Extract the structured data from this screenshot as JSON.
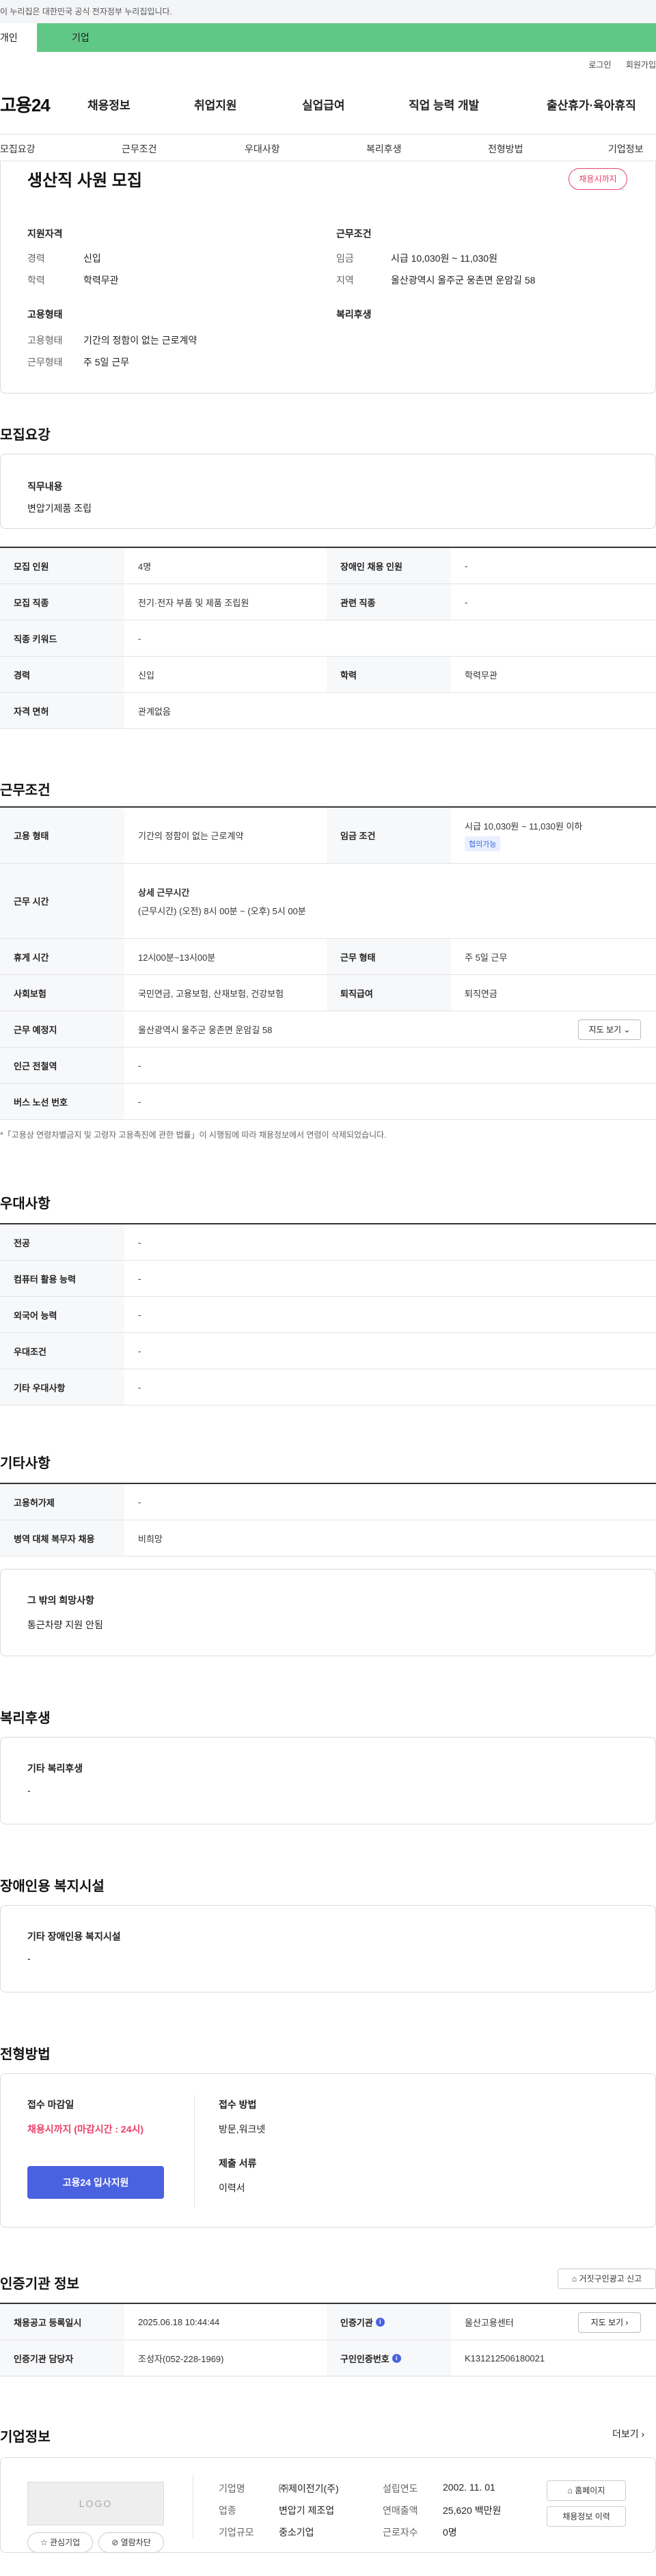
{
  "gov_banner": "이 누리집은 대한민국 공식 전자정부 누리집입니다.",
  "tabs": {
    "personal": "개인",
    "company": "기업"
  },
  "util": {
    "login": "로그인",
    "signup": "회원가입"
  },
  "logo": "고용24",
  "gnb": [
    "채용정보",
    "취업지원",
    "실업급여",
    "직업 능력 개발",
    "출산휴가·육아휴직"
  ],
  "subnav": [
    "모집요강",
    "근무조건",
    "우대사항",
    "복리후생",
    "전형방법",
    "기업정보"
  ],
  "job": {
    "title": "생산직 사원 모집",
    "deadline_badge": "채용시까지",
    "qual_heading": "지원자격",
    "cond_heading": "근무조건",
    "career_label": "경력",
    "career": "신입",
    "edu_label": "학력",
    "edu": "학력무관",
    "wage_label": "임금",
    "wage": "시급 10,030원 ~ 11,030원",
    "region_label": "지역",
    "region": "울산광역시 울주군 웅촌면 운암길 58",
    "emptype_heading": "고용형태",
    "welfare_heading": "복리후생",
    "emptype_label": "고용형태",
    "emptype": "기간의 정함이 없는 근로계약",
    "worktype_label": "근무형태",
    "worktype": "주 5일 근무"
  },
  "recruit": {
    "title": "모집요강",
    "duty_heading": "직무내용",
    "duty": "변압기제품 조립",
    "rows": [
      [
        "모집 인원",
        "4명",
        "장애인 채용 인원",
        "-"
      ],
      [
        "모집 직종",
        "전기·전자 부품 및 제품 조립원",
        "관련 직종",
        "-"
      ],
      [
        "직종 키워드",
        "-",
        "",
        ""
      ],
      [
        "경력",
        "신입",
        "학력",
        "학력무관"
      ],
      [
        "자격 면허",
        "관계없음",
        "",
        ""
      ]
    ]
  },
  "work": {
    "title": "근무조건",
    "emptype_th": "고용 형태",
    "emptype": "기간의 정함이 없는 근로계약",
    "wage_th": "임금 조건",
    "wage": "시급 10,030원 ~ 11,030원 이하",
    "wage_tag": "협의가능",
    "hours_th": "근무 시간",
    "hours_h": "상세 근무시간",
    "hours": "(근무시간) (오전) 8시 00분 ~ (오후) 5시 00분",
    "break_th": "휴게 시간",
    "break": "12시00분~13시00분",
    "worktype_th": "근무 형태",
    "worktype": "주 5일 근무",
    "insurance_th": "사회보험",
    "insurance": "국민연금, 고용보험, 산재보험, 건강보험",
    "severance_th": "퇴직급여",
    "severance": "퇴직연금",
    "place_th": "근무 예정지",
    "place": "울산광역시 울주군 웅촌면 운암길 58",
    "map_btn": "지도 보기",
    "station_th": "인근 전철역",
    "station": "-",
    "bus_th": "버스 노선 번호",
    "bus": "-",
    "note": "*「고용상 연령차별금지 및 고령자 고용촉진에 관한 법률」이 시행됨에 따라 채용정보에서 연령이 삭제되었습니다."
  },
  "pref": {
    "title": "우대사항",
    "rows": [
      [
        "전공",
        "-"
      ],
      [
        "컴퓨터 활용 능력",
        "-"
      ],
      [
        "외국어 능력",
        "-"
      ],
      [
        "우대조건",
        "-"
      ],
      [
        "기타 우대사항",
        "-"
      ]
    ]
  },
  "etc": {
    "title": "기타사항",
    "rows": [
      [
        "고용허가제",
        "-"
      ],
      [
        "병역 대체 복무자 채용",
        "비희망"
      ]
    ],
    "wish_heading": "그 밖의 희망사항",
    "wish": "통근차량 지원 안됨"
  },
  "welfare": {
    "title": "복리후생",
    "heading": "기타 복리후생",
    "value": "-"
  },
  "disab": {
    "title": "장애인용 복지시설",
    "heading": "기타 장애인용 복지시설",
    "value": "-"
  },
  "screening": {
    "title": "전형방법",
    "deadline_h": "접수 마감일",
    "deadline": "채용시까지 (마감시간 : 24시)",
    "apply_btn": "고용24 입사지원",
    "method_h": "접수 방법",
    "method": "방문,워크넷",
    "docs_h": "제출 서류",
    "docs": "이력서"
  },
  "agency": {
    "title": "인증기관 정보",
    "report_btn": "거짓구인광고 신고",
    "reg_th": "채용공고 등록일시",
    "reg": "2025.06.18 10:44:44",
    "org_th": "인증기관",
    "org": "울산고용센터",
    "map_btn": "지도 보기",
    "mgr_th": "인증기관 담당자",
    "mgr": "조성자(052-228-1969)",
    "num_th": "구인인증번호",
    "num": "K131212506180021"
  },
  "company": {
    "title": "기업정보",
    "more": "더보기",
    "logo": "LOGO",
    "fav_btn": "관심기업",
    "block_btn": "열람차단",
    "name_l": "기업명",
    "name": "㈜제이전기(주)",
    "found_l": "설립연도",
    "found": "2002. 11. 01",
    "ind_l": "업종",
    "ind": "변압기 제조업",
    "sales_l": "연매출액",
    "sales": "25,620 백만원",
    "size_l": "기업규모",
    "size": "중소기업",
    "emp_l": "근로자수",
    "emp": "0명",
    "home_btn": "홈페이지",
    "history_btn": "채용정보 이력"
  }
}
